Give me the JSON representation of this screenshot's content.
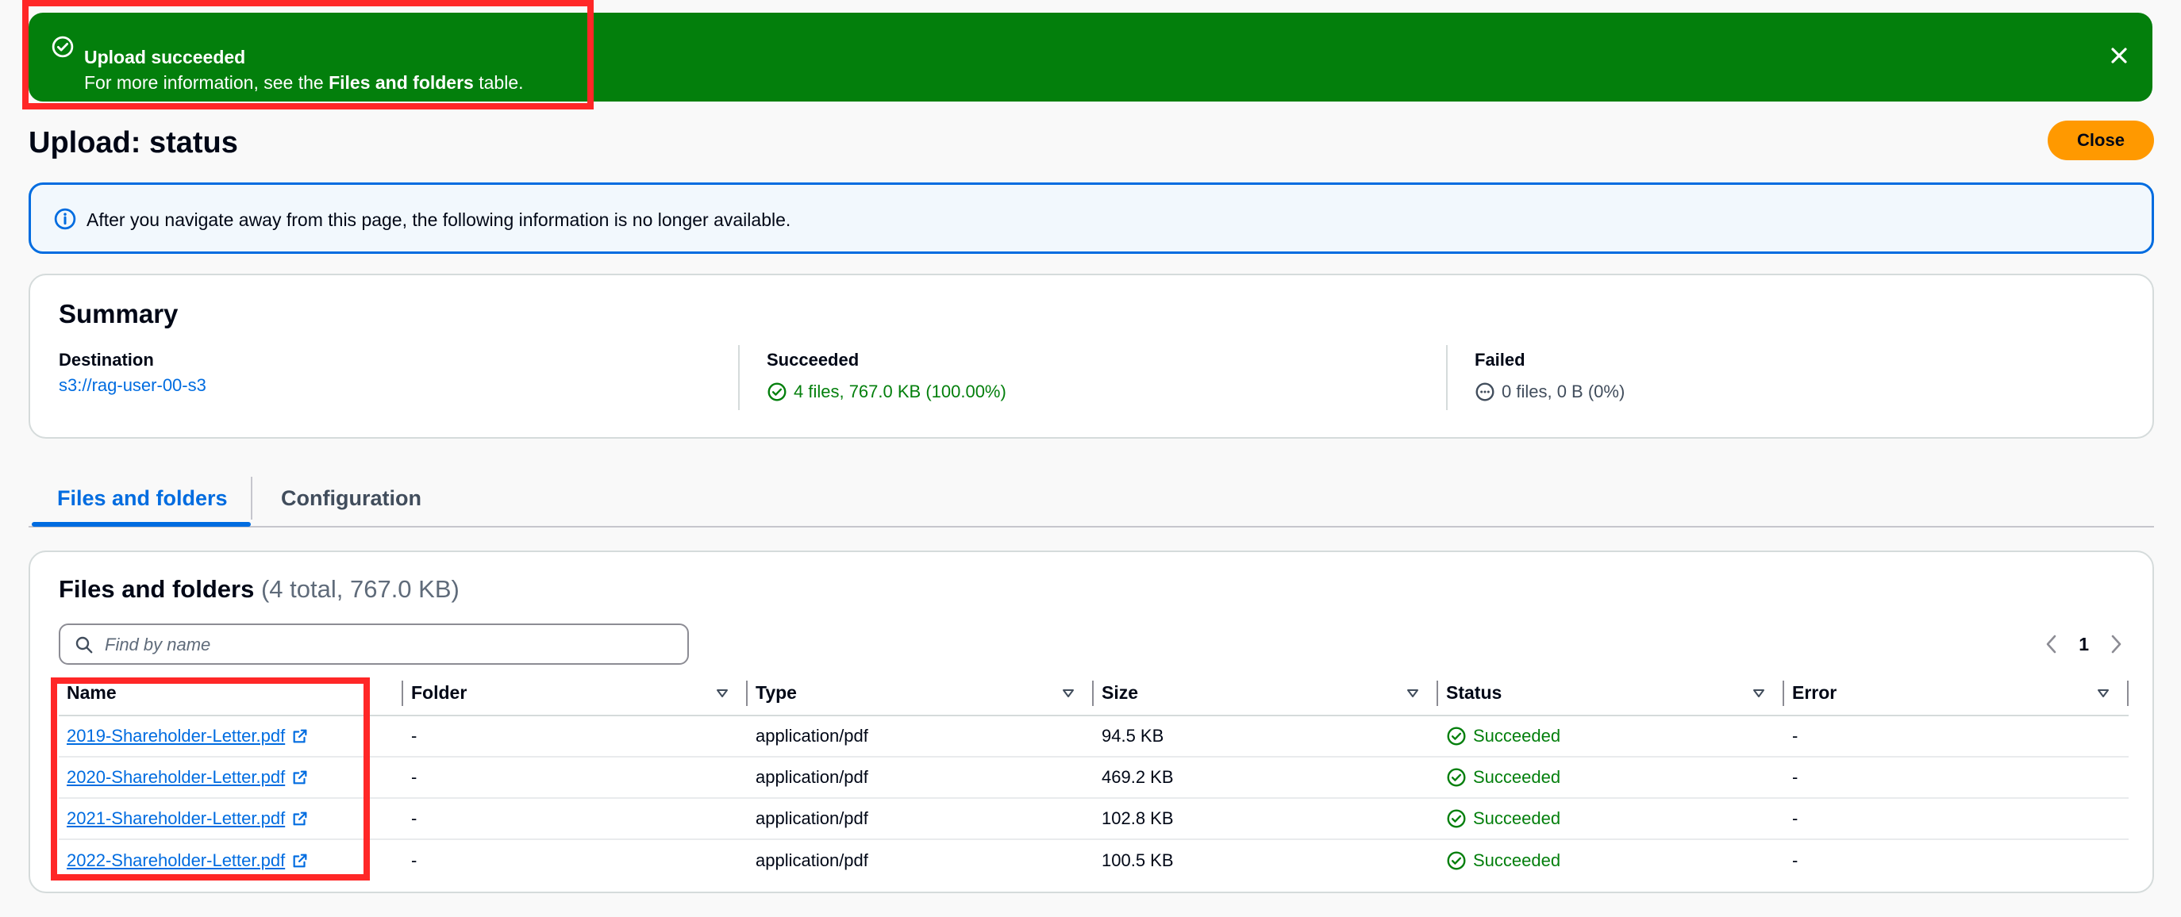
{
  "flash": {
    "title": "Upload succeeded",
    "message_prefix": "For more information, see the ",
    "message_bold": "Files and folders",
    "message_suffix": " table.",
    "color": "#037f0c"
  },
  "page": {
    "title": "Upload: status",
    "close_label": "Close"
  },
  "info_alert": {
    "text": "After you navigate away from this page, the following information is no longer available."
  },
  "summary": {
    "title": "Summary",
    "destination": {
      "label": "Destination",
      "value": "s3://rag-user-00-s3"
    },
    "succeeded": {
      "label": "Succeeded",
      "value": "4 files, 767.0 KB (100.00%)"
    },
    "failed": {
      "label": "Failed",
      "value": "0 files, 0 B (0%)"
    }
  },
  "tabs": [
    {
      "label": "Files and folders",
      "active": true
    },
    {
      "label": "Configuration",
      "active": false
    }
  ],
  "files": {
    "title": "Files and folders",
    "count": "(4 total, 767.0 KB)",
    "search_placeholder": "Find by name",
    "page_number": "1",
    "columns": [
      "Name",
      "Folder",
      "Type",
      "Size",
      "Status",
      "Error"
    ],
    "rows": [
      {
        "name": "2019-Shareholder-Letter.pdf",
        "folder": "-",
        "type": "application/pdf",
        "size": "94.5 KB",
        "status": "Succeeded",
        "error": "-"
      },
      {
        "name": "2020-Shareholder-Letter.pdf",
        "folder": "-",
        "type": "application/pdf",
        "size": "469.2 KB",
        "status": "Succeeded",
        "error": "-"
      },
      {
        "name": "2021-Shareholder-Letter.pdf",
        "folder": "-",
        "type": "application/pdf",
        "size": "102.8 KB",
        "status": "Succeeded",
        "error": "-"
      },
      {
        "name": "2022-Shareholder-Letter.pdf",
        "folder": "-",
        "type": "application/pdf",
        "size": "100.5 KB",
        "status": "Succeeded",
        "error": "-"
      }
    ]
  }
}
